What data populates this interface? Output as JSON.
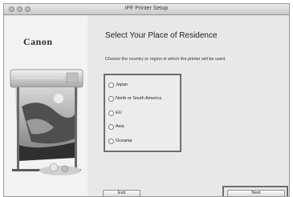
{
  "window": {
    "title": "iPF Printer Setup"
  },
  "sidebar": {
    "logo_text": "Canon"
  },
  "content": {
    "heading": "Select Your Place of Residence",
    "instructions": "Choose the country or region in which the printer will be used.",
    "options": [
      {
        "label": "Japan"
      },
      {
        "label": "North or South America"
      },
      {
        "label": "EU"
      },
      {
        "label": "Asia"
      },
      {
        "label": "Oceania"
      }
    ],
    "selected_option": null
  },
  "buttons": {
    "exit": "Exit",
    "next": "Next"
  }
}
